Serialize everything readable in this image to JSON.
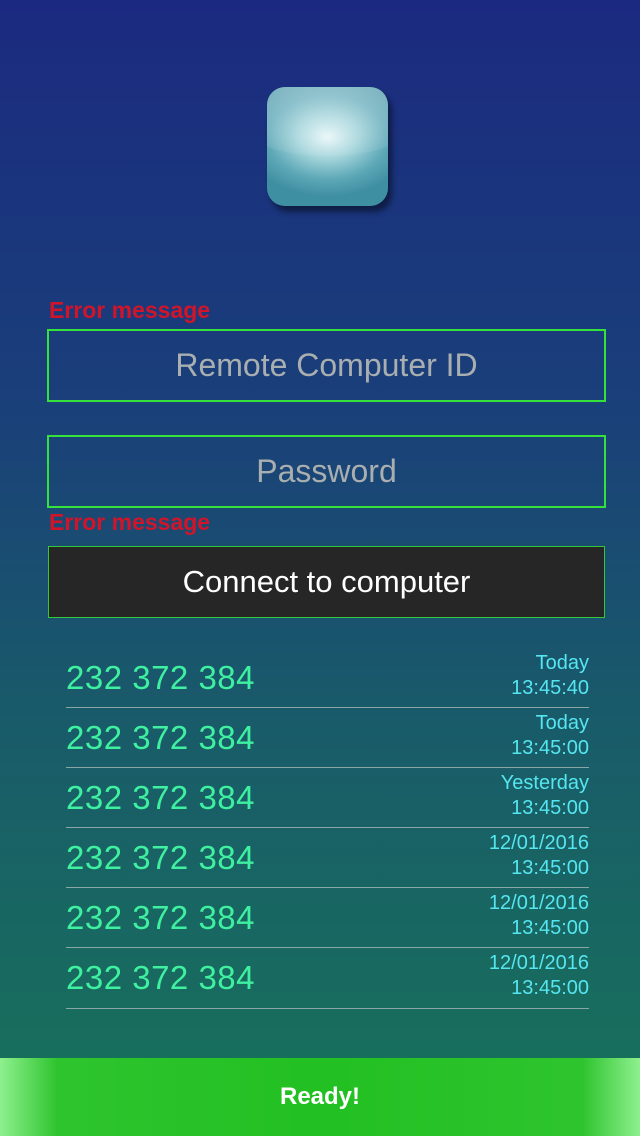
{
  "app": {
    "icon": "app-glossy-icon"
  },
  "remote_id": {
    "error": "Error message",
    "placeholder": "Remote Computer ID",
    "value": ""
  },
  "password": {
    "error": "Error message",
    "placeholder": "Password",
    "value": ""
  },
  "connect_button": {
    "label": "Connect to computer"
  },
  "history": [
    {
      "id": "232 372 384",
      "date": "Today",
      "time": "13:45:40"
    },
    {
      "id": "232 372 384",
      "date": "Today",
      "time": "13:45:00"
    },
    {
      "id": "232 372 384",
      "date": "Yesterday",
      "time": "13:45:00"
    },
    {
      "id": "232 372 384",
      "date": "12/01/2016",
      "time": "13:45:00"
    },
    {
      "id": "232 372 384",
      "date": "12/01/2016",
      "time": "13:45:00"
    },
    {
      "id": "232 372 384",
      "date": "12/01/2016",
      "time": "13:45:00"
    }
  ],
  "status": {
    "text": "Ready!"
  },
  "colors": {
    "field_border": "#35e23a",
    "error": "#d0152a",
    "history_id": "#3ef0a0",
    "history_time": "#55e6f0",
    "status_bar": "#22c022"
  }
}
